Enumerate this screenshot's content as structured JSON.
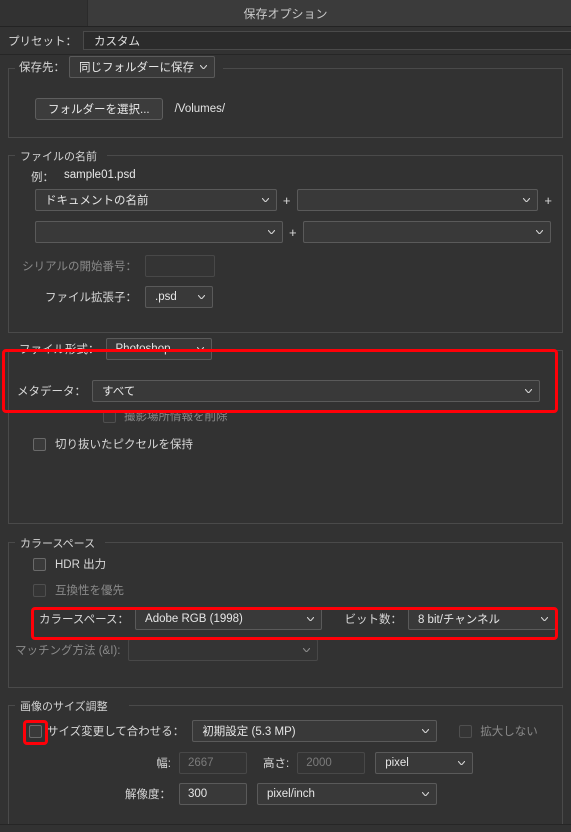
{
  "window": {
    "title": "保存オプション"
  },
  "preset": {
    "label": "プリセット：",
    "value": "カスタム"
  },
  "destination": {
    "legend_label": "保存先：",
    "value": "同じフォルダーに保存",
    "choose_folder_button": "フォルダーを選択...",
    "path": "/Volumes/"
  },
  "file_name": {
    "legend": "ファイルの名前",
    "example_label": "例：",
    "example_value": "sample01.psd",
    "segment_1": "ドキュメントの名前",
    "segment_2": "",
    "segment_3": "",
    "segment_4": "",
    "plus_1": "+",
    "plus_2": "+",
    "plus_3": "+",
    "serial_label": "シリアルの開始番号：",
    "serial_value": "",
    "extension_label": "ファイル拡張子：",
    "extension_value": ".psd"
  },
  "file_format": {
    "legend_label": "ファイル形式：",
    "format_value": "Photoshop",
    "metadata_label": "メタデータ：",
    "metadata_value": "すべて",
    "remove_location_label": "撮影場所情報を削除",
    "remove_location_checked": false,
    "keep_cropped_pixels_label": "切り抜いたピクセルを保持",
    "keep_cropped_pixels_checked": false
  },
  "color_space": {
    "legend": "カラースペース",
    "hdr_label": "HDR 出力",
    "hdr_checked": false,
    "compat_label": "互換性を優先",
    "compat_checked": false,
    "profile_label": "カラースペース：",
    "profile_value": "Adobe RGB (1998)",
    "bit_depth_label": "ビット数：",
    "bit_depth_value": "8 bit/チャンネル",
    "matching_label": "マッチング方法 (&I):",
    "matching_value": ""
  },
  "image_size": {
    "legend": "画像のサイズ調整",
    "resize_label": "サイズ変更して合わせる：",
    "resize_checked": false,
    "resize_preset_value": "初期設定 (5.3 MP)",
    "no_upscale_label": "拡大しない",
    "no_upscale_checked": false,
    "width_label": "幅:",
    "width_value": "2667",
    "height_label": "高さ:",
    "height_value": "2000",
    "size_unit_value": "pixel",
    "resolution_label": "解像度：",
    "resolution_value": "300",
    "resolution_unit_value": "pixel/inch"
  },
  "colors": {
    "highlight": "#ff0008",
    "panel_bg": "#323232",
    "field_bg": "#393939",
    "title_bg": "#3b3b3b"
  },
  "annotations": {
    "highlight_1": "file-format-and-metadata",
    "highlight_2": "color-space-and-bit-depth",
    "highlight_3": "resize-to-fit-checkbox"
  }
}
